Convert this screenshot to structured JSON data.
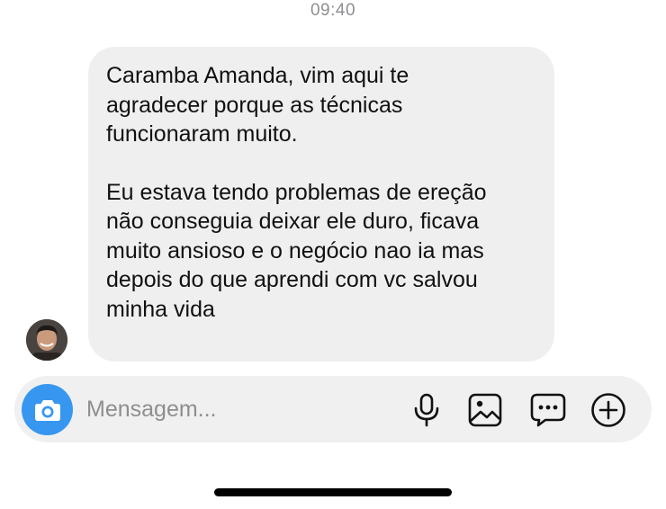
{
  "header": {
    "timestamp": "09:40"
  },
  "thread": {
    "messages": [
      {
        "sender": "contact",
        "paragraphs": [
          "Caramba Amanda, vim aqui te\nagradecer porque as técnicas\nfuncionaram muito.",
          "Eu estava tendo problemas de ereção\nnão conseguia deixar ele duro, ficava\nmuito ansioso e o negócio nao ia mas\ndepois do que aprendi com vc salvou\nminha vida"
        ]
      }
    ]
  },
  "composer": {
    "placeholder": "Mensagem...",
    "value": "",
    "icons": {
      "camera": "camera-icon",
      "mic": "microphone-icon",
      "gallery": "gallery-icon",
      "sticker": "sticker-icon",
      "add": "plus-circle-icon"
    }
  },
  "colors": {
    "accent": "#3797f0",
    "bubble": "#efefef",
    "composer": "#f0f0f0",
    "timestamp": "#8e8e93"
  }
}
